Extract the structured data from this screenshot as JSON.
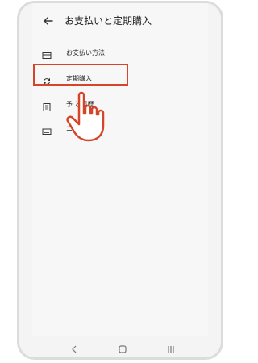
{
  "header": {
    "title": "お支払いと定期購入"
  },
  "menu": [
    {
      "label": "お支払い方法",
      "icon": "credit-card-icon"
    },
    {
      "label": "定期購入",
      "icon": "sync-icon"
    },
    {
      "label": "予算と履歴",
      "label_visible": "予  と履歴",
      "icon": "receipt-list-icon"
    },
    {
      "label": "コードを使用",
      "label_visible": "ニ          用",
      "icon": "redeem-icon"
    }
  ],
  "nav": {
    "back": "back-nav-icon",
    "home": "home-nav-icon",
    "recents": "recents-nav-icon"
  },
  "colors": {
    "highlight": "#d4452a",
    "hand": "#d4452a"
  }
}
